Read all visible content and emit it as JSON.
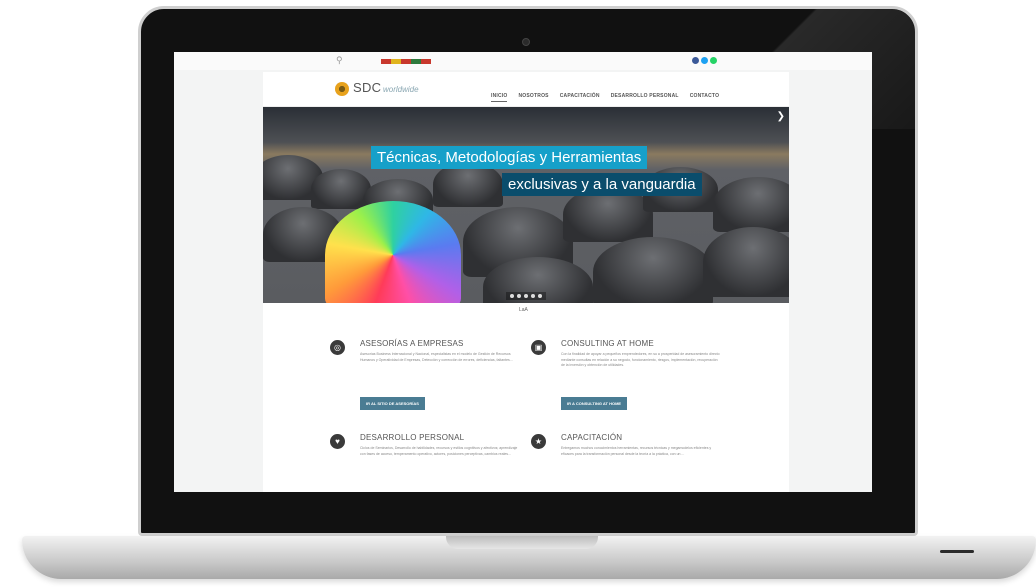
{
  "site": {
    "brand": "SDC",
    "brand_sub": "worldwide",
    "nav": [
      "INICIO",
      "NOSOTROS",
      "CAPACITACIÓN",
      "DESARROLLO PERSONAL",
      "CONTACTO"
    ],
    "active_nav": "INICIO"
  },
  "hero": {
    "line1": "Técnicas, Metodologías y Herramientas",
    "line2": "exclusivas y a la vanguardia",
    "accent_light": "#16a0c9",
    "accent_dark": "#0a4d6c",
    "slide_count": 5
  },
  "mini_label": "LaA",
  "services": [
    {
      "title": "ASESORÍAS A EMPRESAS",
      "text": "Asesorías Business Internacional y Nacional, especialistas en el modelo de Gestión de Recursos Humanos y Operatividad de Empresas, Detección y corrección de errores, deficiencias, faltantes...",
      "button": "IR AL SITIO DE ASESORÍAS",
      "icon": "globe-icon"
    },
    {
      "title": "CONSULTING AT HOME",
      "text": "Con la finalidad de apoyar a pequeños emprendedores, en su a prosperidad de asesoramiento directo mediante consultas en relación a su negocio, funcionamiento, riesgos, implementación, recuperación de la inversión y obtención de utilidades.",
      "button": "IR A CONSULTING AT HOME",
      "icon": "cart-icon"
    },
    {
      "title": "DESARROLLO PERSONAL",
      "text": "Ciclos de Seminarios, Desarrollo de habilidades, recursos y estilos cognitivos y afectivos; aprendizaje con fases de acceso, temperamento operativo, actores, posiciones perceptivas, cambios reales...",
      "button": "",
      "icon": "heart-icon"
    },
    {
      "title": "CAPACITACIÓN",
      "text": "Entregamos muchos conocimientos herramientas, recursos técnicas y megamodelos eficientes y eficaces para la transformación personal desde la teoría a la práctica, con un ...",
      "button": "",
      "icon": "star-icon"
    }
  ],
  "socials": [
    {
      "name": "facebook-icon",
      "color": "#3b5998"
    },
    {
      "name": "twitter-icon",
      "color": "#1da1f2"
    },
    {
      "name": "whatsapp-icon",
      "color": "#25d366"
    }
  ]
}
